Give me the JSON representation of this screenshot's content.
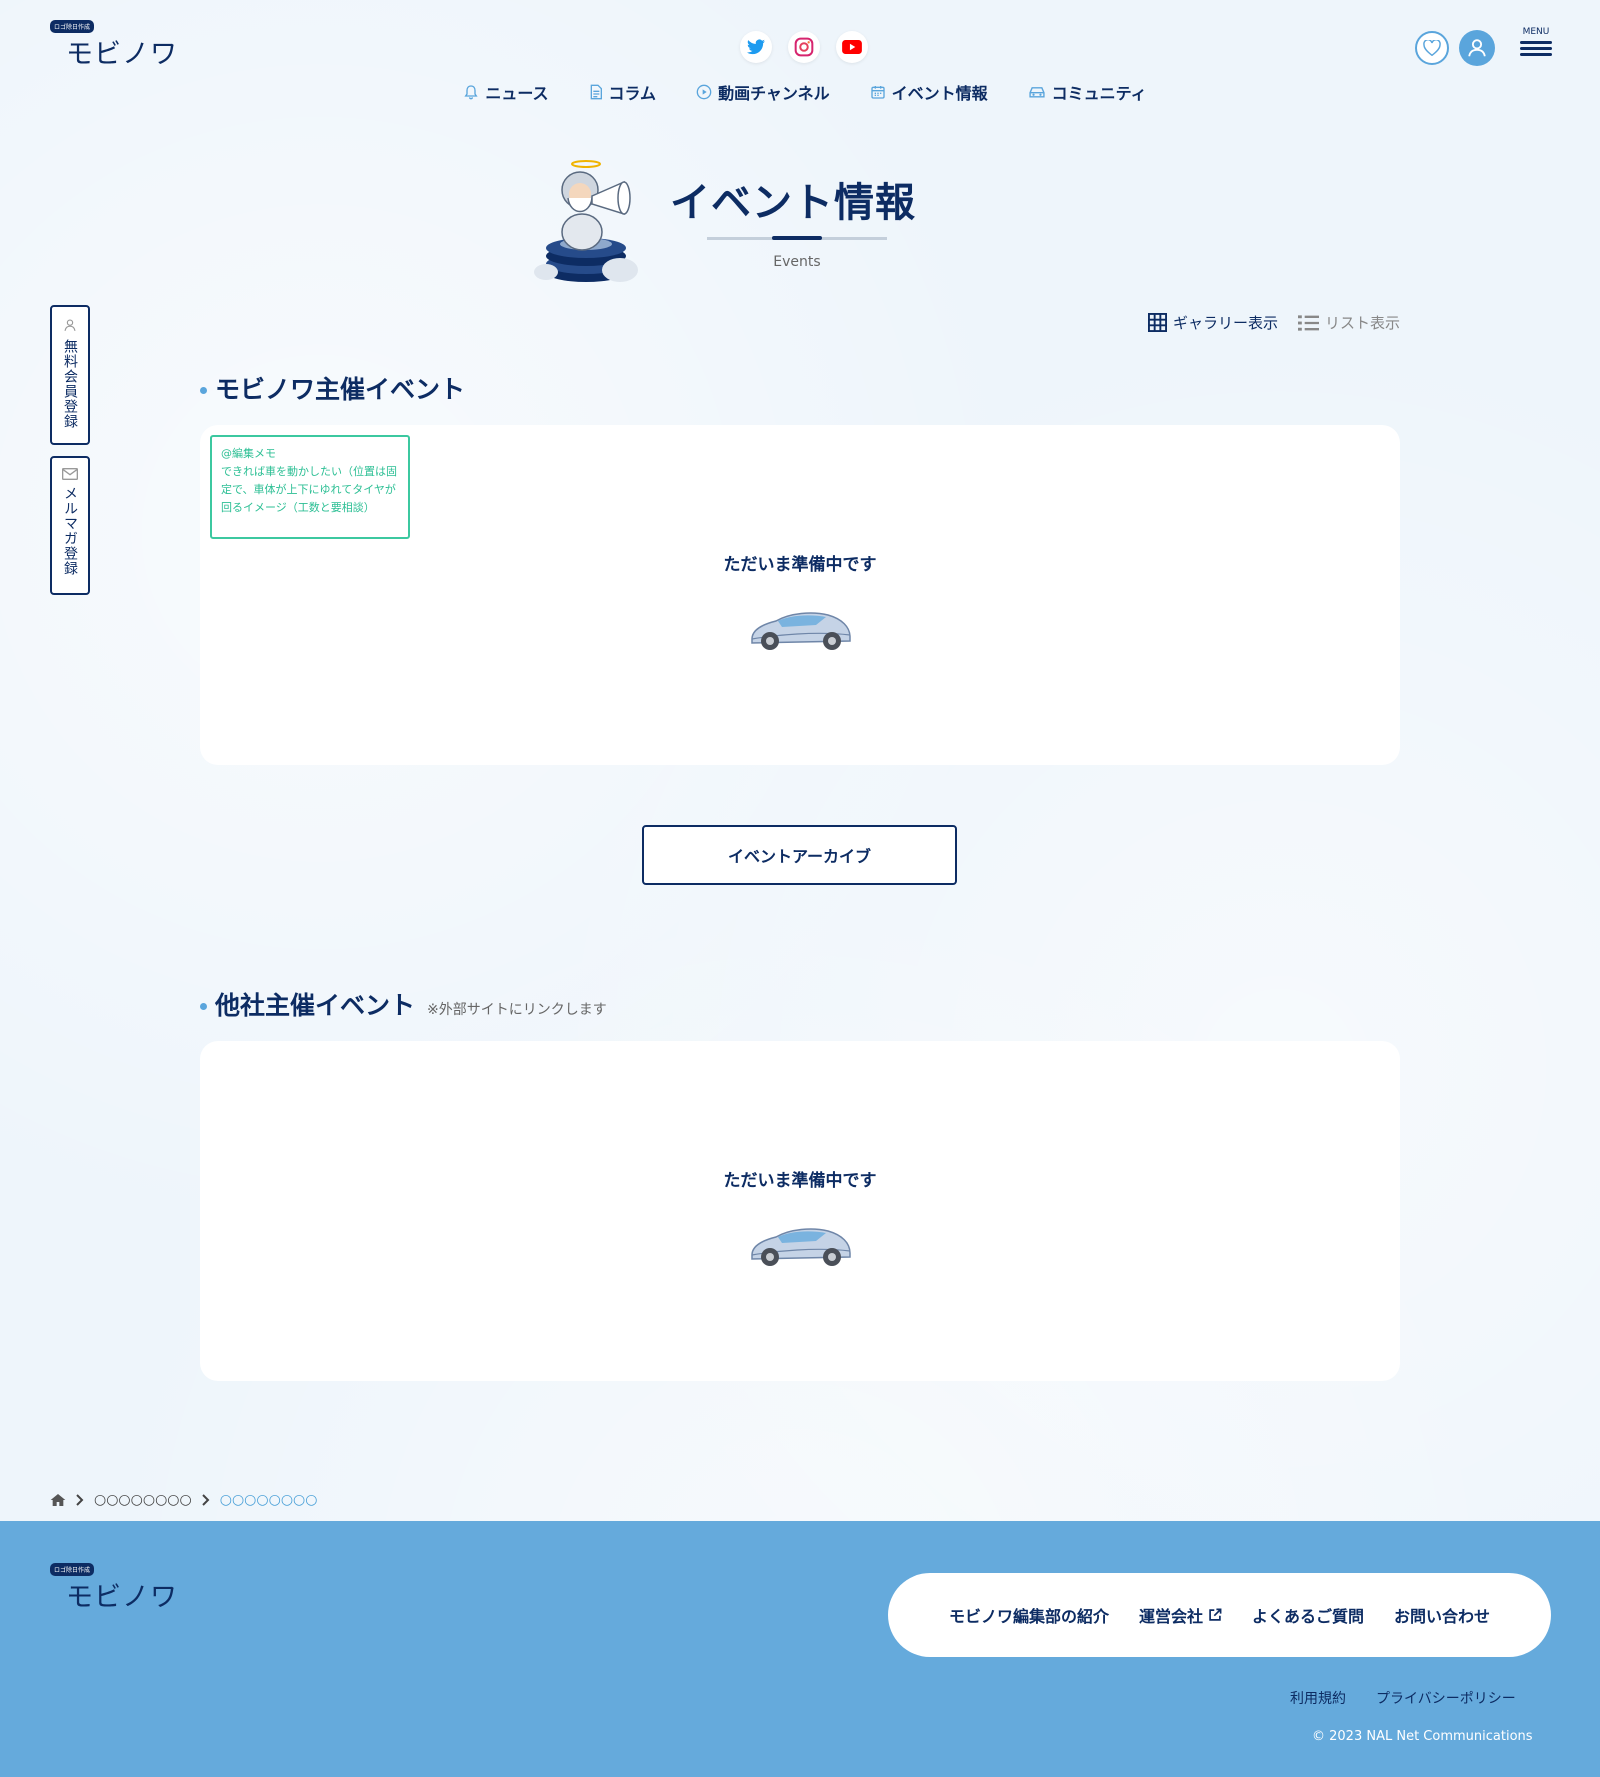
{
  "header": {
    "logo_badge": "ロゴ除日作成",
    "logo_text": "モビノワ",
    "menu_label": "MENU"
  },
  "nav": {
    "items": [
      {
        "label": "ニュース",
        "icon": "bell-icon"
      },
      {
        "label": "コラム",
        "icon": "document-icon"
      },
      {
        "label": "動画チャンネル",
        "icon": "play-icon"
      },
      {
        "label": "イベント情報",
        "icon": "calendar-icon"
      },
      {
        "label": "コミュニティ",
        "icon": "car-icon"
      }
    ]
  },
  "side_tabs": {
    "register": "無料会員登録",
    "newsletter": "メルマガ登録"
  },
  "page": {
    "title": "イベント情報",
    "subtitle": "Events"
  },
  "view_toggle": {
    "gallery": "ギャラリー表示",
    "list": "リスト表示"
  },
  "sections": {
    "hosted": {
      "title": "モビノワ主催イベント",
      "empty_message": "ただいま準備中です"
    },
    "external": {
      "title": "他社主催イベント",
      "note": "※外部サイトにリンクします",
      "empty_message": "ただいま準備中です"
    }
  },
  "memo": {
    "line1": "@編集メモ",
    "line2": "できれば車を動かしたい（位置は固",
    "line3": "定で、車体が上下にゆれてタイヤが",
    "line4": "回るイメージ（工数と要相談）"
  },
  "archive_button": "イベントアーカイブ",
  "breadcrumb": {
    "item1": "○○○○○○○○",
    "item2": "○○○○○○○○"
  },
  "footer": {
    "nav": [
      "モビノワ編集部の紹介",
      "運営会社",
      "よくあるご質問",
      "お問い合わせ"
    ],
    "terms": "利用規約",
    "privacy": "プライバシーポリシー",
    "copyright": "© 2023 NAL Net Communications"
  },
  "colors": {
    "navy": "#0d2c63",
    "accent_blue": "#5aa5dc",
    "footer_bg": "#65aadc",
    "memo_green": "#3cc8a0"
  }
}
